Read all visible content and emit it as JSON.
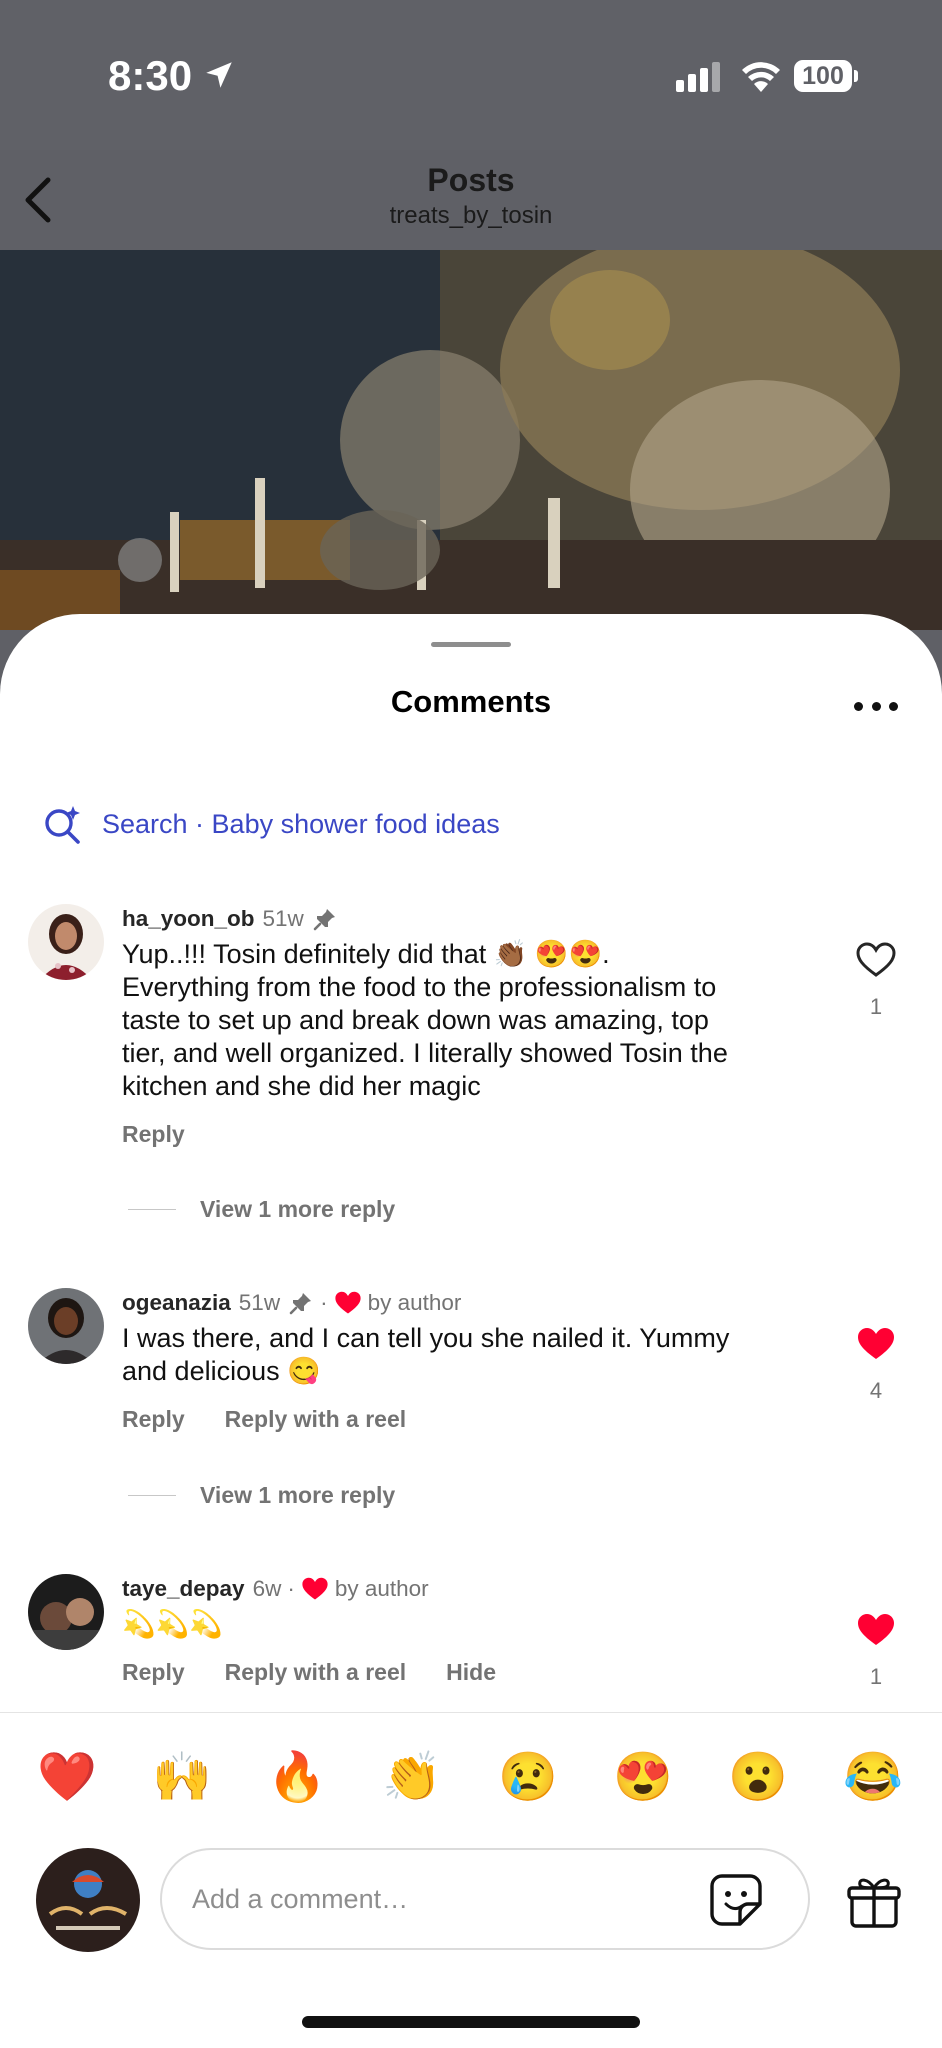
{
  "status": {
    "time": "8:30",
    "battery": "100"
  },
  "nav": {
    "title": "Posts",
    "subtitle": "treats_by_tosin"
  },
  "sheet": {
    "title": "Comments"
  },
  "search": {
    "label": "Search · Baby shower food ideas"
  },
  "comments": [
    {
      "username": "ha_yoon_ob",
      "age": "51w",
      "text_lines": [
        "Yup..!!! Tosin  definitely did that 👏🏾 😍😍.",
        "Everything from the food to the professionalism to",
        "taste to set up and break down was  amazing, top",
        "tier, and well organized.  I literally  showed Tosin the",
        "kitchen and she did her magic"
      ],
      "actions": [
        "Reply"
      ],
      "likes": "1",
      "liked": false,
      "view_more": "View 1 more reply"
    },
    {
      "username": "ogeanazia",
      "age": "51w",
      "by_author": "by author",
      "text_lines": [
        "I was there, and I can tell you she nailed it. Yummy",
        "and delicious 😋"
      ],
      "actions": [
        "Reply",
        "Reply with a reel"
      ],
      "likes": "4",
      "liked": true,
      "view_more": "View 1 more reply"
    },
    {
      "username": "taye_depay",
      "age": "6w",
      "by_author": "by author",
      "text_lines": [
        "💫💫💫"
      ],
      "actions": [
        "Reply",
        "Reply with a reel",
        "Hide"
      ],
      "likes": "1",
      "liked": true
    }
  ],
  "emoji_bar": [
    {
      "icon": "red-heart-emoji",
      "glyph": "❤️"
    },
    {
      "icon": "raising-hands-emoji",
      "glyph": "🙌"
    },
    {
      "icon": "fire-emoji",
      "glyph": "🔥"
    },
    {
      "icon": "clapping-hands-emoji",
      "glyph": "👏"
    },
    {
      "icon": "crying-face-emoji",
      "glyph": "😢"
    },
    {
      "icon": "heart-eyes-emoji",
      "glyph": "😍"
    },
    {
      "icon": "surprised-face-emoji",
      "glyph": "😮"
    },
    {
      "icon": "tears-of-joy-emoji",
      "glyph": "😂"
    }
  ],
  "composer": {
    "placeholder": "Add a comment…"
  },
  "colors": {
    "accent_blue": "#3a47c5",
    "like_red": "#ff0033",
    "muted": "#737373"
  }
}
